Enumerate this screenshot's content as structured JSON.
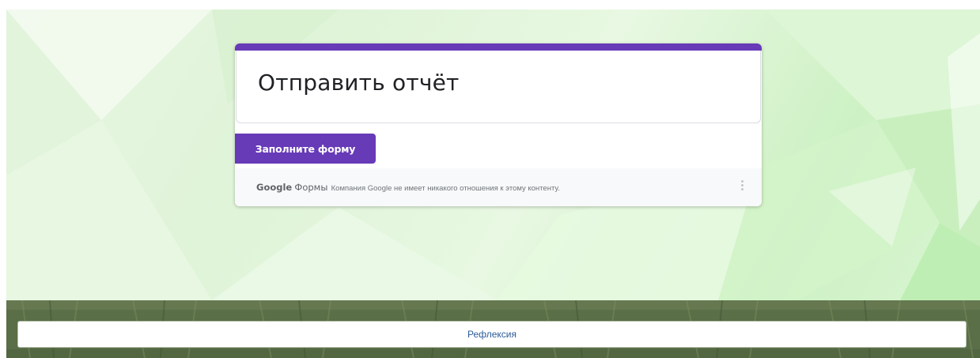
{
  "form": {
    "title": "Отправить отчёт",
    "fill_button_label": "Заполните форму",
    "footer": {
      "brand_google": "Google",
      "brand_forms": "Формы",
      "disclaimer": "Компания Google не имеет никакого отношения к этому контенту."
    },
    "accent_color": "#673ab7"
  },
  "reflection_button_label": "Рефлексия",
  "icons": [
    "more-vert-icon"
  ]
}
